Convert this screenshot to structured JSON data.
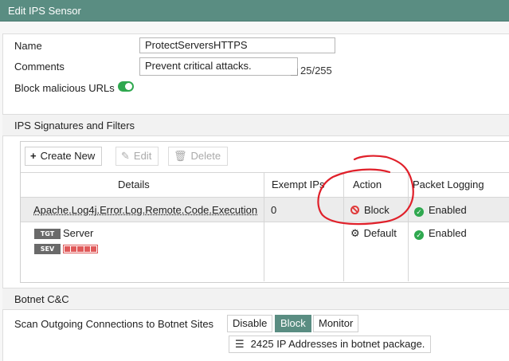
{
  "title": "Edit IPS Sensor",
  "form": {
    "name_label": "Name",
    "name_value": "ProtectServersHTTPS",
    "comments_label": "Comments",
    "comments_value": "Prevent critical attacks.",
    "comments_counter": "25/255",
    "block_urls_label": "Block malicious URLs",
    "block_urls_enabled": true
  },
  "signatures": {
    "section_title": "IPS Signatures and Filters",
    "toolbar": {
      "create": "Create New",
      "edit": "Edit",
      "delete": "Delete"
    },
    "columns": [
      "Details",
      "Exempt IPs",
      "Action",
      "Packet Logging"
    ],
    "rows": [
      {
        "details": "Apache.Log4j.Error.Log.Remote.Code.Execution",
        "exempt": "0",
        "action": "Block",
        "logging": "Enabled"
      },
      {
        "tgt_tag": "TGT",
        "tgt_value": "Server",
        "sev_tag": "SEV",
        "severity_level": 5,
        "action": "Default",
        "logging": "Enabled"
      }
    ]
  },
  "botnet": {
    "section_title": "Botnet C&C",
    "scan_label": "Scan Outgoing Connections to Botnet Sites",
    "options": [
      "Disable",
      "Block",
      "Monitor"
    ],
    "selected": "Block",
    "info": "2425 IP Addresses in botnet package."
  },
  "colors": {
    "header": "#5a8d82",
    "enabled": "#2fa84f",
    "block": "#e03b3b",
    "annotation": "#e0202a"
  }
}
